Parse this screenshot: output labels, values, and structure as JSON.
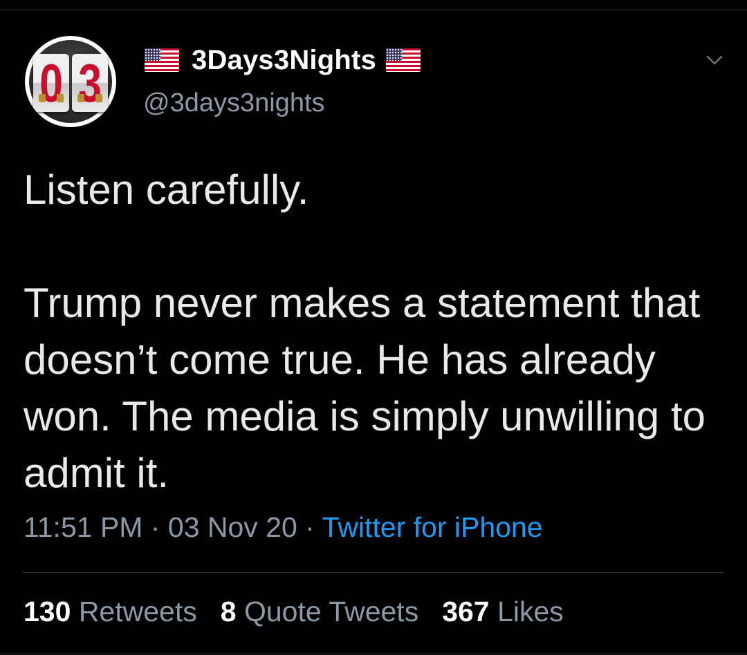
{
  "tweet": {
    "display_name": "3Days3Nights",
    "handle": "@3days3nights",
    "avatar_digits": [
      "0",
      "3"
    ],
    "text": "Listen carefully.\n\nTrump never makes a statement that doesn’t come true. He has already won. The media is simply unwilling to admit it.",
    "time": "11:51 PM",
    "date": "03 Nov 20",
    "separator": " · ",
    "source": "Twitter for iPhone",
    "stats": {
      "retweets_count": "130",
      "retweets_label": "Retweets",
      "quote_tweets_count": "8",
      "quote_tweets_label": "Quote Tweets",
      "likes_count": "367",
      "likes_label": "Likes"
    }
  },
  "icons": {
    "name_prefix": "us-flag-icon",
    "name_suffix": "us-flag-icon",
    "menu": "chevron-down-icon"
  },
  "colors": {
    "background": "#000000",
    "text": "#e7e9ea",
    "secondary": "#8b98a5",
    "link": "#1d9bf0",
    "divider": "#2f3336"
  }
}
